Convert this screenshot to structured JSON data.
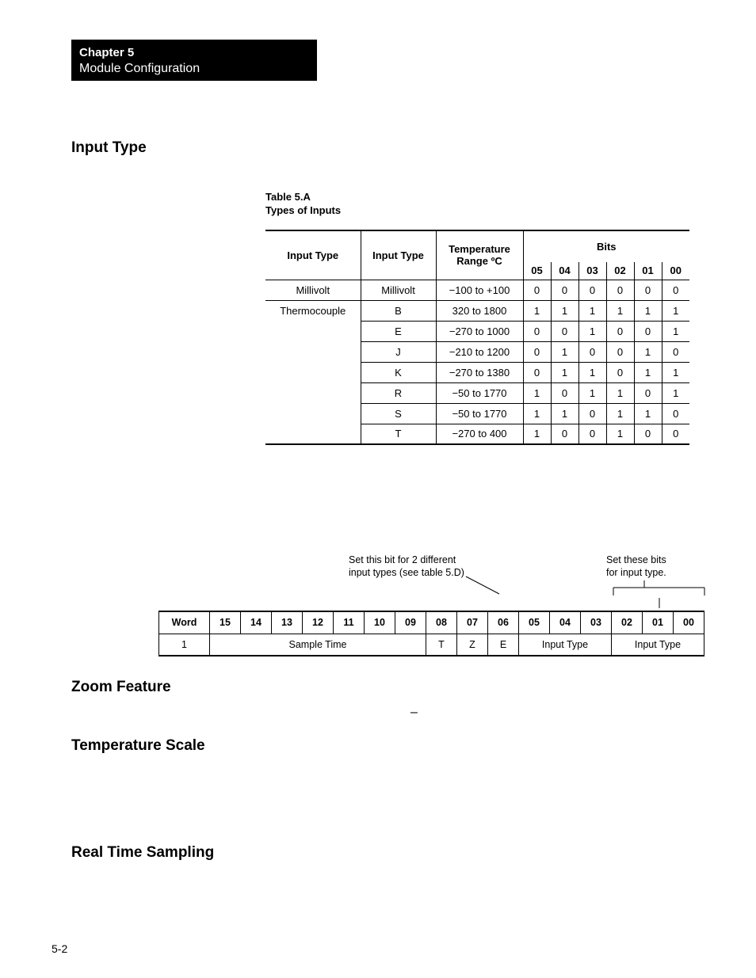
{
  "chapter": {
    "label": "Chapter 5",
    "subtitle": "Module Configuration"
  },
  "sections": {
    "input_type": "Input Type",
    "zoom": "Zoom Feature",
    "temp_scale": "Temperature Scale",
    "rts": "Real Time Sampling"
  },
  "table5a": {
    "title_line1": "Table 5.A",
    "title_line2": "Types of Inputs",
    "headers": {
      "input_type_a": "Input  Type",
      "input_type_b": "Input  Type",
      "temp_line1": "Temperature",
      "temp_line2": "Range ºC",
      "bits": "Bits",
      "b05": "05",
      "b04": "04",
      "b03": "03",
      "b02": "02",
      "b01": "01",
      "b00": "00"
    },
    "rows": [
      {
        "cat": "Millivolt",
        "type": "Millivolt",
        "range": "−100 to +100",
        "b": [
          "0",
          "0",
          "0",
          "0",
          "0",
          "0"
        ]
      },
      {
        "cat": "Thermocouple",
        "type": "B",
        "range": "320 to 1800",
        "b": [
          "1",
          "1",
          "1",
          "1",
          "1",
          "1"
        ]
      },
      {
        "cat": "",
        "type": "E",
        "range": "−270 to 1000",
        "b": [
          "0",
          "0",
          "1",
          "0",
          "0",
          "1"
        ]
      },
      {
        "cat": "",
        "type": "J",
        "range": "−210 to 1200",
        "b": [
          "0",
          "1",
          "0",
          "0",
          "1",
          "0"
        ]
      },
      {
        "cat": "",
        "type": "K",
        "range": "−270 to 1380",
        "b": [
          "0",
          "1",
          "1",
          "0",
          "1",
          "1"
        ]
      },
      {
        "cat": "",
        "type": "R",
        "range": "−50 to 1770",
        "b": [
          "1",
          "0",
          "1",
          "1",
          "0",
          "1"
        ]
      },
      {
        "cat": "",
        "type": "S",
        "range": "−50 to 1770",
        "b": [
          "1",
          "1",
          "0",
          "1",
          "1",
          "0"
        ]
      },
      {
        "cat": "",
        "type": "T",
        "range": "−270 to 400",
        "b": [
          "1",
          "0",
          "0",
          "1",
          "0",
          "0"
        ]
      }
    ]
  },
  "bit_diagram": {
    "anno_left_line1": "Set this bit for 2 different",
    "anno_left_line2": "input types (see table 5.D)",
    "anno_right_line1": "Set these bits",
    "anno_right_line2": "for input type.",
    "headers": {
      "word": "Word",
      "b15": "15",
      "b14": "14",
      "b13": "13",
      "b12": "12",
      "b11": "11",
      "b10": "10",
      "b09": "09",
      "b08": "08",
      "b07": "07",
      "b06": "06",
      "b05": "05",
      "b04": "04",
      "b03": "03",
      "b02": "02",
      "b01": "01",
      "b00": "00"
    },
    "row": {
      "word": "1",
      "sample_time": "Sample Time",
      "t": "T",
      "z": "Z",
      "e": "E",
      "input_type_a": "Input Type",
      "input_type_b": "Input Type"
    }
  },
  "page_num": "5-2",
  "dash": "–"
}
